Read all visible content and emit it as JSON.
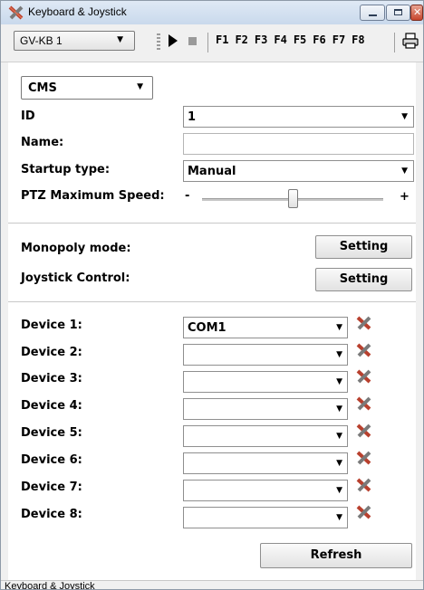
{
  "window": {
    "title": "Keyboard & Joystick"
  },
  "toolbar": {
    "keyboard_select": "GV-KB 1",
    "fkeys": [
      "F1",
      "F2",
      "F3",
      "F4",
      "F5",
      "F6",
      "F7",
      "F8"
    ],
    "play_icon": "play-icon",
    "stop_icon": "stop-icon",
    "print_icon": "print-icon"
  },
  "form": {
    "mode_select": "CMS",
    "id_label": "ID",
    "id_value": "1",
    "name_label": "Name:",
    "name_value": "",
    "startup_label": "Startup type:",
    "startup_value": "Manual",
    "ptz_label": "PTZ Maximum Speed:",
    "ptz_min": "-",
    "ptz_max": "+",
    "ptz_speed_fraction": 0.5
  },
  "settings": {
    "monopoly_label": "Monopoly mode:",
    "joystick_label": "Joystick Control:",
    "setting_button": "Setting"
  },
  "devices": [
    {
      "label": "Device 1:",
      "value": "COM1"
    },
    {
      "label": "Device 2:",
      "value": ""
    },
    {
      "label": "Device 3:",
      "value": ""
    },
    {
      "label": "Device 4:",
      "value": ""
    },
    {
      "label": "Device 5:",
      "value": ""
    },
    {
      "label": "Device 6:",
      "value": ""
    },
    {
      "label": "Device 7:",
      "value": ""
    },
    {
      "label": "Device 8:",
      "value": ""
    }
  ],
  "refresh_button": "Refresh",
  "status": {
    "text": "Keyboard & Joystick"
  }
}
